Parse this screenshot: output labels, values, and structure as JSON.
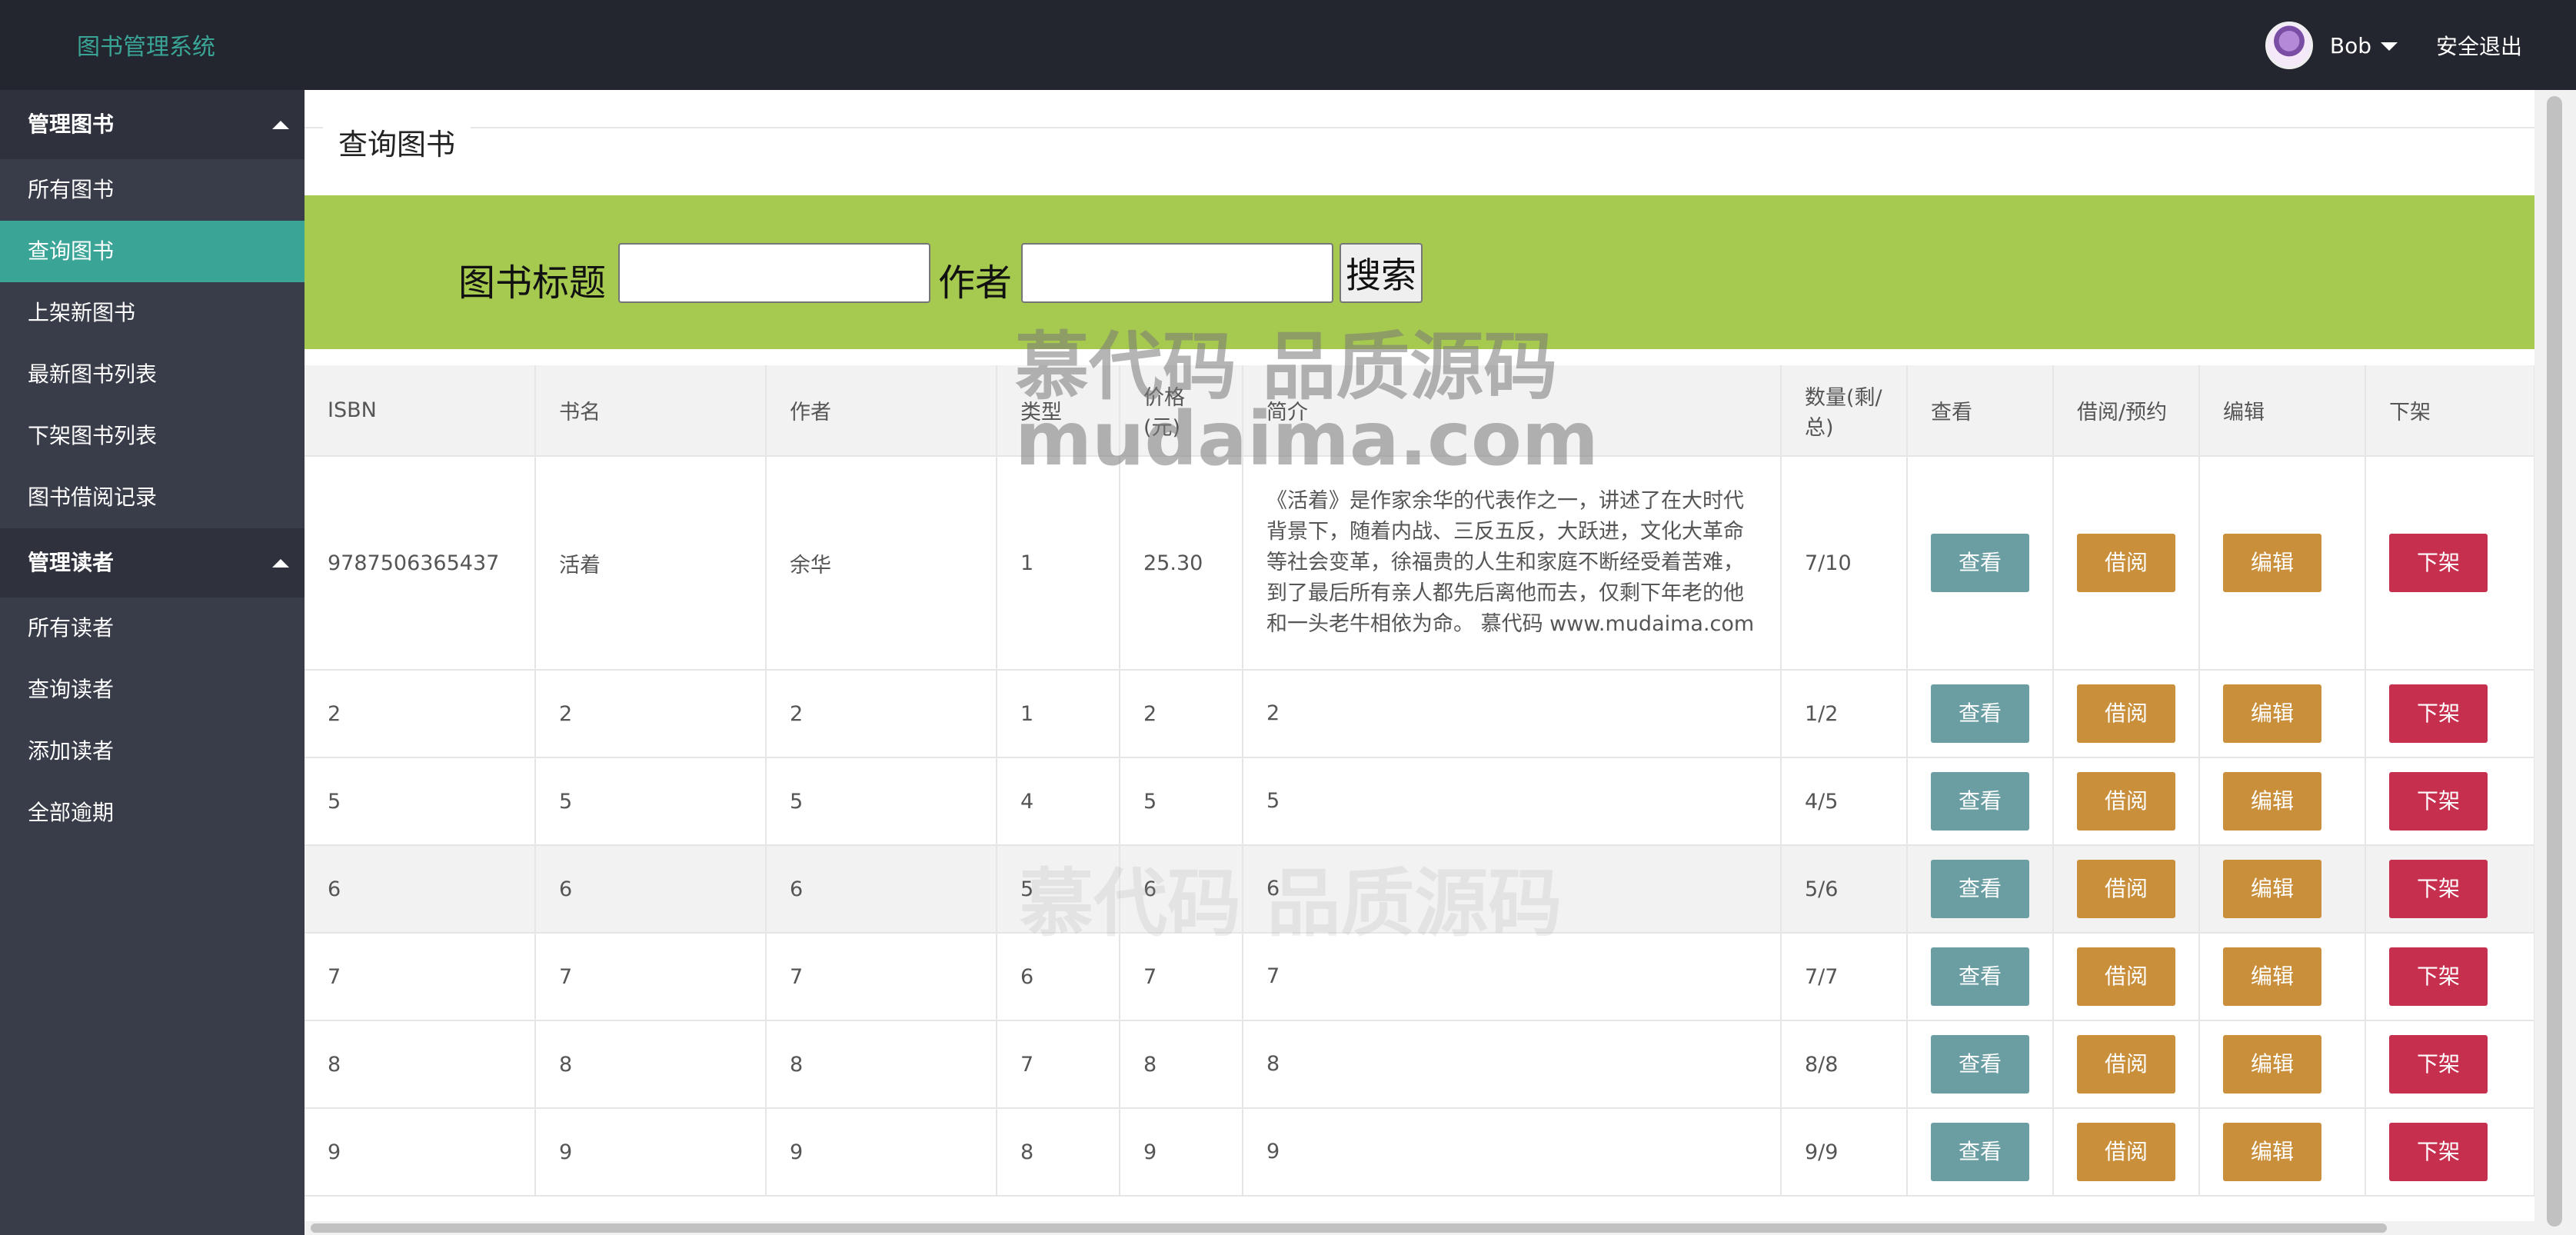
{
  "header": {
    "logo": "图书管理系统",
    "user": "Bob",
    "logout": "安全退出"
  },
  "sidebar": {
    "groups": [
      {
        "label": "管理图书",
        "items": [
          "所有图书",
          "查询图书",
          "上架新图书",
          "最新图书列表",
          "下架图书列表",
          "图书借阅记录"
        ]
      },
      {
        "label": "管理读者",
        "items": [
          "所有读者",
          "查询读者",
          "添加读者",
          "全部逾期"
        ]
      }
    ],
    "active_item": "查询图书"
  },
  "page": {
    "legend": "查询图书",
    "search": {
      "title_label": "图书标题",
      "title_value": "",
      "author_label": "作者",
      "author_value": "",
      "button": "搜索"
    }
  },
  "table": {
    "headers": [
      "ISBN",
      "书名",
      "作者",
      "类型",
      "价格(元)",
      "简介",
      "数量(剩/总)",
      "查看",
      "借阅/预约",
      "编辑",
      "下架"
    ],
    "actions": {
      "view": "查看",
      "borrow": "借阅",
      "edit": "编辑",
      "off": "下架"
    },
    "rows": [
      {
        "isbn": "9787506365437",
        "name": "活着",
        "author": "余华",
        "type": "1",
        "price": "25.30",
        "desc": "《活着》是作家余华的代表作之一，讲述了在大时代背景下，随着内战、三反五反，大跃进，文化大革命等社会变革，徐福贵的人生和家庭不断经受着苦难，到了最后所有亲人都先后离他而去，仅剩下年老的他和一头老牛相依为命。 慕代码 www.mudaima.com",
        "qty": "7/10"
      },
      {
        "isbn": "2",
        "name": "2",
        "author": "2",
        "type": "1",
        "price": "2",
        "desc": "2",
        "qty": "1/2"
      },
      {
        "isbn": "5",
        "name": "5",
        "author": "5",
        "type": "4",
        "price": "5",
        "desc": "5",
        "qty": "4/5"
      },
      {
        "isbn": "6",
        "name": "6",
        "author": "6",
        "type": "5",
        "price": "6",
        "desc": "6",
        "qty": "5/6"
      },
      {
        "isbn": "7",
        "name": "7",
        "author": "7",
        "type": "6",
        "price": "7",
        "desc": "7",
        "qty": "7/7"
      },
      {
        "isbn": "8",
        "name": "8",
        "author": "8",
        "type": "7",
        "price": "8",
        "desc": "8",
        "qty": "8/8"
      },
      {
        "isbn": "9",
        "name": "9",
        "author": "9",
        "type": "8",
        "price": "9",
        "desc": "9",
        "qty": "9/9"
      }
    ]
  },
  "watermark": {
    "line1": "慕代码 品质源码",
    "line2": "mudaima.com"
  },
  "colors": {
    "header_bg": "#23262e",
    "sidebar_bg": "#393d49",
    "active": "#3aa597",
    "search_bg": "#a6c94f",
    "view": "#6a9ea3",
    "borrow": "#c98f3b",
    "off": "#c6304e"
  }
}
